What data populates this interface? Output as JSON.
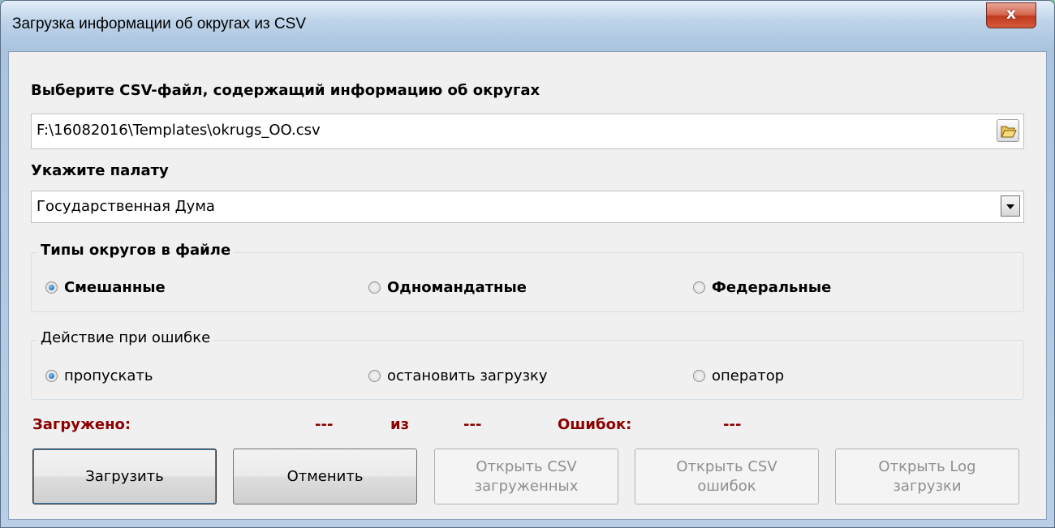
{
  "window": {
    "title": "Загрузка информации об округах из CSV",
    "close_label": "x"
  },
  "file_section": {
    "label": "Выберите CSV-файл, содержащий информацию об округах",
    "path_value": "F:\\16082016\\Templates\\okrugs_OO.csv",
    "browse_icon": "folder-open-icon"
  },
  "chamber_section": {
    "label": "Укажите палату",
    "selected": "Государственная Дума"
  },
  "district_types": {
    "title": "Типы округов в файле",
    "options": [
      {
        "label": "Смешанные",
        "checked": true
      },
      {
        "label": "Одномандатные",
        "checked": false
      },
      {
        "label": "Федеральные",
        "checked": false
      }
    ]
  },
  "error_action": {
    "title": "Действие при ошибке",
    "options": [
      {
        "label": "пропускать",
        "checked": true
      },
      {
        "label": "остановить загрузку",
        "checked": false
      },
      {
        "label": "оператор",
        "checked": false
      }
    ]
  },
  "stats": {
    "loaded_label": "Загружено:",
    "loaded_value": "---",
    "of_label": "из",
    "total_value": "---",
    "errors_label": "Ошибок:",
    "errors_value": "---",
    "color": "#8b0000"
  },
  "buttons": {
    "load": "Загрузить",
    "cancel": "Отменить",
    "open_loaded_csv": "Открыть CSV\nзагруженных",
    "open_error_csv": "Открыть CSV\nошибок",
    "open_log": "Открыть Log\nзагрузки"
  }
}
